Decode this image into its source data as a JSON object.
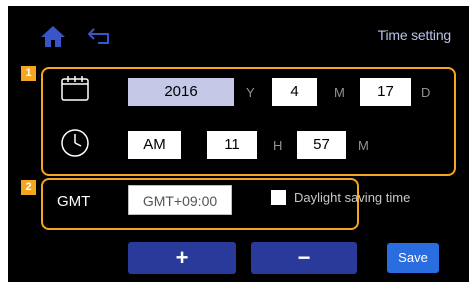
{
  "header": {
    "title": "Time setting",
    "home_icon": "home-icon",
    "back_icon": "back-arrow-icon",
    "accent_color": "#3a55c8"
  },
  "badges": [
    "1",
    "2"
  ],
  "date": {
    "year": "2016",
    "year_unit": "Y",
    "month": "4",
    "month_unit": "M",
    "day": "17",
    "day_unit": "D",
    "icon": "calendar-icon"
  },
  "time": {
    "period": "AM",
    "hour": "11",
    "hour_unit": "H",
    "minute": "57",
    "minute_unit": "M",
    "icon": "clock-icon"
  },
  "timezone": {
    "label": "GMT",
    "value": "GMT+09:00",
    "dst_label": "Daylight saving time",
    "dst_checked": false
  },
  "buttons": {
    "plus": "+",
    "minus": "−",
    "save": "Save"
  },
  "colors": {
    "highlight_border": "#f5a61e",
    "selected_field": "#c5c8e6",
    "button": "#2a3a9a",
    "save_button": "#2a6de0"
  }
}
